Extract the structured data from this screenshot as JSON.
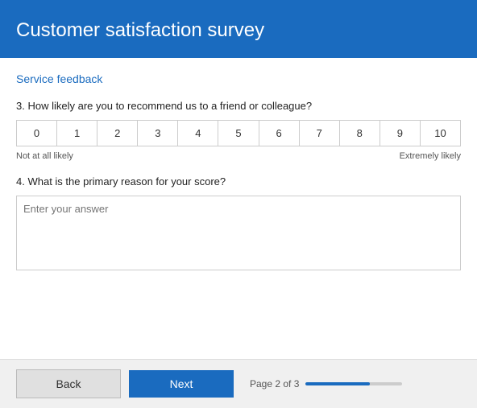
{
  "header": {
    "title": "Customer satisfaction survey"
  },
  "section": {
    "label": "Service feedback"
  },
  "questions": {
    "q3": {
      "number": "3.",
      "text": "How likely are you to recommend us to a friend or colleague?",
      "scale_min_label": "Not at all likely",
      "scale_max_label": "Extremely likely",
      "scale_values": [
        "0",
        "1",
        "2",
        "3",
        "4",
        "5",
        "6",
        "7",
        "8",
        "9",
        "10"
      ]
    },
    "q4": {
      "number": "4.",
      "text": "What is the primary reason for your score?",
      "placeholder": "Enter your answer"
    }
  },
  "footer": {
    "back_label": "Back",
    "next_label": "Next",
    "page_indicator": "Page 2 of 3",
    "progress_percent": 66
  }
}
